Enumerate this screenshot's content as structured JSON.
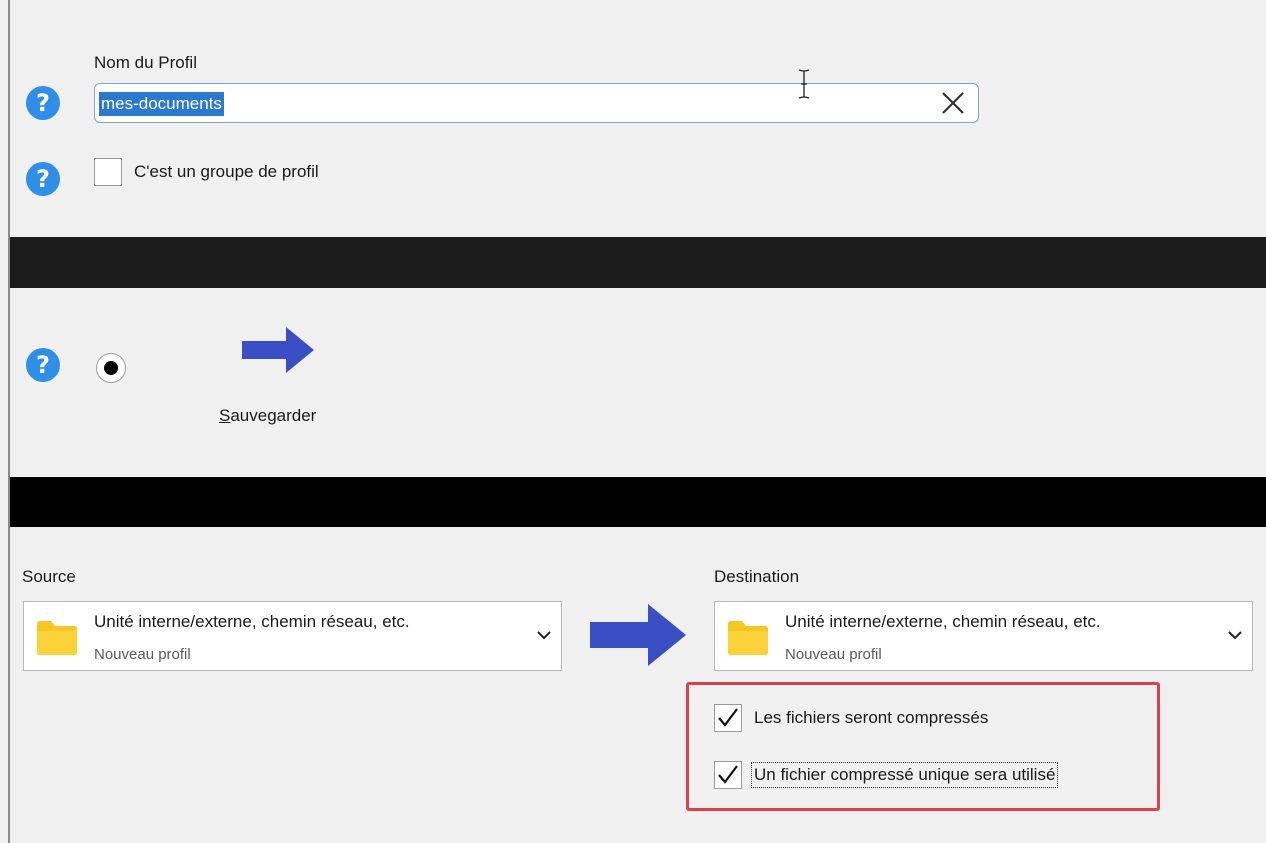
{
  "profile": {
    "name_label": "Nom du Profil",
    "name_value": "mes-documents",
    "group_label": "C'est un groupe de profil"
  },
  "action": {
    "label_rest": "auvegarder",
    "label_underlined": "S"
  },
  "transfer": {
    "source_label": "Source",
    "source_main": "Unité interne/externe, chemin réseau, etc.",
    "source_sub": "Nouveau profil",
    "destination_label": "Destination",
    "destination_main": "Unité interne/externe, chemin réseau, etc.",
    "destination_sub": "Nouveau profil"
  },
  "options": {
    "compress_label": "Les fichiers seront compressés",
    "single_archive_label": "Un fichier compressé unique sera utilisé"
  },
  "icons": {
    "help": "help-question-icon",
    "clear": "close-x-icon",
    "arrow": "arrow-right-icon",
    "folder": "folder-icon",
    "chevron": "chevron-down-icon",
    "check": "checkmark-icon"
  },
  "colors": {
    "help_blue": "#2f8fe8",
    "arrow_blue": "#3b4fc4",
    "folder_yellow": "#f8c623",
    "highlight_red": "#d9414b",
    "selection_blue": "#2a78d0"
  }
}
